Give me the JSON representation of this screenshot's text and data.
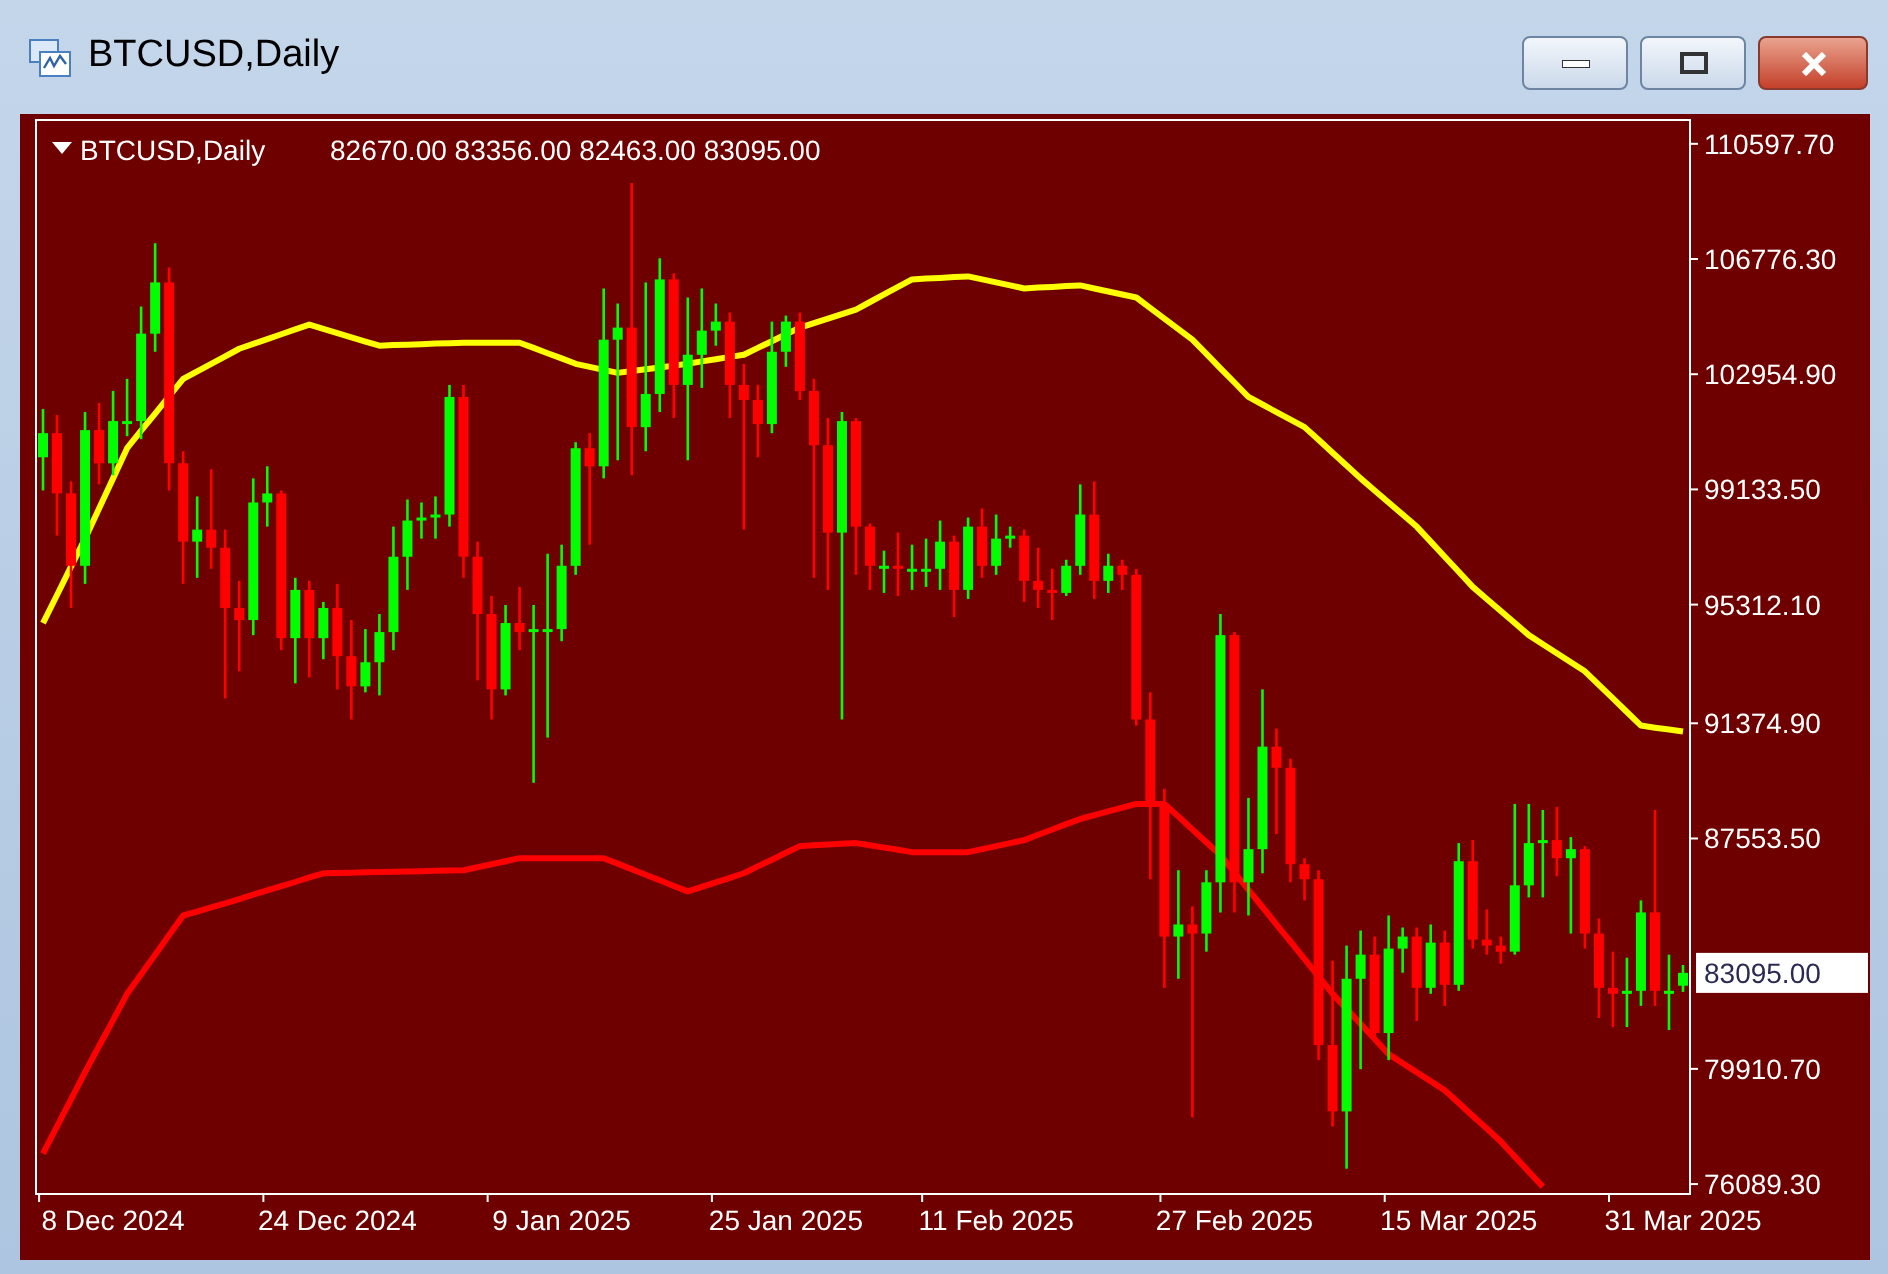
{
  "window": {
    "title": "BTCUSD,Daily"
  },
  "chart": {
    "header": {
      "symbol": "BTCUSD,Daily",
      "quote": "82670.00 83356.00 82463.00 83095.00"
    },
    "price_label": "83095.00",
    "chart_data": {
      "type": "candlestick",
      "ylim": [
        75760,
        111388
      ],
      "categories": [
        null,
        null,
        null,
        null,
        null,
        "8 Dec 2024",
        null,
        null,
        null,
        null,
        null,
        null,
        null,
        null,
        null,
        null,
        null,
        null,
        null,
        null,
        null,
        "24 Dec 2024",
        null,
        null,
        null,
        null,
        null,
        null,
        null,
        null,
        null,
        null,
        null,
        null,
        null,
        null,
        null,
        "9 Jan 2025",
        null,
        null,
        null,
        null,
        null,
        null,
        null,
        null,
        null,
        null,
        null,
        null,
        null,
        null,
        null,
        "25 Jan 2025",
        null,
        null,
        null,
        null,
        null,
        null,
        null,
        null,
        null,
        null,
        null,
        null,
        null,
        null,
        "11 Feb 2025",
        null,
        null,
        null,
        null,
        null,
        null,
        null,
        null,
        null,
        null,
        null,
        null,
        null,
        null,
        null,
        null,
        "27 Feb 2025",
        null,
        null,
        null,
        null,
        null,
        null,
        null,
        null,
        null,
        null,
        null,
        null,
        null,
        null,
        null,
        "15 Mar 2025",
        null,
        null,
        null,
        null,
        null,
        null,
        null,
        null,
        null,
        null,
        null,
        null,
        null,
        null,
        null,
        "31 Mar 2025"
      ],
      "yticks": [
        {
          "value": 110597.7,
          "label": "110597.70"
        },
        {
          "value": 106776.3,
          "label": "106776.30"
        },
        {
          "value": 102954.9,
          "label": "102954.90"
        },
        {
          "value": 99133.5,
          "label": "99133.50"
        },
        {
          "value": 95312.1,
          "label": "95312.10"
        },
        {
          "value": 91374.9,
          "label": "91374.90"
        },
        {
          "value": 87553.5,
          "label": "87553.50"
        },
        {
          "value": 79910.7,
          "label": "79910.70"
        },
        {
          "value": 76089.3,
          "label": "76089.30"
        }
      ],
      "series": [
        {
          "type": "line",
          "color": "#ffff00",
          "values": [
            94700,
            95630,
            96570,
            97500,
            98500,
            99500,
            100500,
            101080,
            101650,
            102230,
            102800,
            103050,
            103300,
            103550,
            103800,
            103960,
            104120,
            104280,
            104440,
            104600,
            104460,
            104320,
            104180,
            104040,
            103900,
            103920,
            103930,
            103950,
            103970,
            103980,
            104000,
            104000,
            104000,
            104000,
            104000,
            103830,
            103650,
            103480,
            103300,
            103200,
            103100,
            103000,
            103060,
            103120,
            103180,
            103240,
            103300,
            103380,
            103450,
            103530,
            103600,
            103830,
            104050,
            104280,
            104500,
            104650,
            104800,
            104950,
            105100,
            105350,
            105600,
            105850,
            106100,
            106130,
            106150,
            106180,
            106200,
            106100,
            106000,
            105900,
            105800,
            105830,
            105850,
            105880,
            105900,
            105800,
            105700,
            105600,
            105500,
            105150,
            104800,
            104450,
            104100,
            103630,
            103150,
            102680,
            102200,
            101950,
            101700,
            101450,
            101200,
            100780,
            100350,
            99930,
            99500,
            99100,
            98700,
            98300,
            97900,
            97400,
            96900,
            96400,
            95900,
            95500,
            95100,
            94700,
            94300,
            94000,
            93700,
            93400,
            93100,
            92650,
            92200,
            91750,
            91300,
            91230,
            91170,
            91100
          ]
        },
        {
          "type": "line",
          "color": "#ff0000",
          "values": [
            77100,
            78000,
            78900,
            79800,
            80670,
            81530,
            82400,
            83050,
            83700,
            84350,
            85000,
            85130,
            85270,
            85400,
            85540,
            85690,
            85830,
            85970,
            86110,
            86260,
            86400,
            86410,
            86420,
            86430,
            86440,
            86450,
            86460,
            86470,
            86480,
            86490,
            86500,
            86600,
            86700,
            86800,
            86900,
            86900,
            86900,
            86900,
            86900,
            86900,
            86900,
            86720,
            86530,
            86350,
            86170,
            85980,
            85800,
            85950,
            86100,
            86250,
            86400,
            86630,
            86850,
            87080,
            87300,
            87330,
            87350,
            87380,
            87400,
            87330,
            87250,
            87180,
            87100,
            87100,
            87100,
            87100,
            87100,
            87200,
            87300,
            87400,
            87500,
            87680,
            87850,
            88030,
            88200,
            88330,
            88450,
            88580,
            88700,
            88700,
            88700,
            88280,
            87850,
            87430,
            87000,
            86430,
            85850,
            85280,
            84700,
            84130,
            83550,
            82980,
            82400,
            81900,
            81400,
            80900,
            80400,
            80100,
            79800,
            79500,
            79200,
            78780,
            78350,
            77930,
            77500,
            77000,
            76500,
            76000,
            null,
            null,
            null,
            null,
            null,
            null,
            null,
            null,
            null,
            null
          ]
        }
      ],
      "ohlc": [
        [
          100200,
          101800,
          99100,
          101000
        ],
        [
          101000,
          101600,
          97600,
          99000
        ],
        [
          99000,
          99400,
          95200,
          96600
        ],
        [
          96600,
          101700,
          96000,
          101100
        ],
        [
          101100,
          102000,
          99300,
          100000
        ],
        [
          100000,
          102400,
          99600,
          101400
        ],
        [
          101400,
          102800,
          100900,
          101400
        ],
        [
          101400,
          105200,
          100800,
          104300
        ],
        [
          104300,
          107300,
          103700,
          106000
        ],
        [
          106000,
          106500,
          99100,
          100000
        ],
        [
          100000,
          100400,
          96000,
          97400
        ],
        [
          97400,
          98900,
          96200,
          97800
        ],
        [
          97800,
          99800,
          96500,
          97200
        ],
        [
          97200,
          97800,
          92200,
          95200
        ],
        [
          95200,
          96100,
          93100,
          94800
        ],
        [
          94800,
          99500,
          94300,
          98700
        ],
        [
          98700,
          99900,
          97900,
          99000
        ],
        [
          99000,
          99100,
          93800,
          94200
        ],
        [
          94200,
          96200,
          92700,
          95800
        ],
        [
          95800,
          96100,
          92900,
          94200
        ],
        [
          94200,
          95400,
          93500,
          95200
        ],
        [
          95200,
          96000,
          92500,
          93600
        ],
        [
          93600,
          94800,
          91500,
          92600
        ],
        [
          92600,
          94500,
          92400,
          93400
        ],
        [
          93400,
          95000,
          92300,
          94400
        ],
        [
          94400,
          97900,
          93800,
          96900
        ],
        [
          96900,
          98800,
          95800,
          98100
        ],
        [
          98100,
          98700,
          97500,
          98200
        ],
        [
          98200,
          98900,
          97500,
          98300
        ],
        [
          98300,
          102600,
          97900,
          102200
        ],
        [
          102200,
          102600,
          96200,
          96900
        ],
        [
          96900,
          97400,
          92800,
          95000
        ],
        [
          95000,
          95600,
          91500,
          92500
        ],
        [
          92500,
          95300,
          92300,
          94700
        ],
        [
          94700,
          95900,
          93800,
          94400
        ],
        [
          94400,
          95300,
          89400,
          94500
        ],
        [
          94500,
          97000,
          90900,
          94500
        ],
        [
          94500,
          97300,
          94100,
          96600
        ],
        [
          96600,
          100700,
          96300,
          100500
        ],
        [
          100500,
          101000,
          97300,
          99900
        ],
        [
          99900,
          105800,
          99500,
          104100
        ],
        [
          104100,
          105300,
          100100,
          104500
        ],
        [
          104500,
          109300,
          99600,
          101200
        ],
        [
          101200,
          106000,
          100400,
          102300
        ],
        [
          102300,
          106800,
          101700,
          106100
        ],
        [
          106100,
          106300,
          101500,
          102600
        ],
        [
          102600,
          105500,
          100100,
          103600
        ],
        [
          103600,
          105800,
          102500,
          104400
        ],
        [
          104400,
          105300,
          103900,
          104700
        ],
        [
          104700,
          105000,
          101500,
          102600
        ],
        [
          102600,
          103300,
          97800,
          102100
        ],
        [
          102100,
          102600,
          100200,
          101300
        ],
        [
          101300,
          104700,
          101000,
          103700
        ],
        [
          103700,
          104900,
          103200,
          104700
        ],
        [
          104700,
          105000,
          102100,
          102400
        ],
        [
          102400,
          102800,
          96200,
          100600
        ],
        [
          100600,
          101500,
          95800,
          97700
        ],
        [
          97700,
          101700,
          91500,
          101400
        ],
        [
          101400,
          101500,
          96300,
          97900
        ],
        [
          97900,
          98000,
          95800,
          96600
        ],
        [
          96600,
          97100,
          95700,
          96600
        ],
        [
          96600,
          97700,
          95600,
          96500
        ],
        [
          96500,
          97300,
          95800,
          96500
        ],
        [
          96500,
          97500,
          95900,
          96500
        ],
        [
          96500,
          98100,
          95800,
          97400
        ],
        [
          97400,
          97600,
          94900,
          95800
        ],
        [
          95800,
          98200,
          95500,
          97900
        ],
        [
          97900,
          98500,
          96200,
          96600
        ],
        [
          96600,
          98300,
          96300,
          97500
        ],
        [
          97500,
          97900,
          97200,
          97600
        ],
        [
          97600,
          97800,
          95400,
          96100
        ],
        [
          96100,
          97200,
          95200,
          95800
        ],
        [
          95800,
          96500,
          94800,
          95700
        ],
        [
          95700,
          96800,
          95600,
          96600
        ],
        [
          96600,
          99300,
          96300,
          98300
        ],
        [
          98300,
          99400,
          95500,
          96100
        ],
        [
          96100,
          97000,
          95700,
          96600
        ],
        [
          96600,
          96800,
          95800,
          96300
        ],
        [
          96300,
          96500,
          91300,
          91500
        ],
        [
          91500,
          92400,
          86200,
          88700
        ],
        [
          88700,
          89200,
          82600,
          84300
        ],
        [
          84300,
          86500,
          82900,
          84700
        ],
        [
          84700,
          85300,
          78300,
          84400
        ],
        [
          84400,
          86500,
          83800,
          86100
        ],
        [
          86100,
          95000,
          85100,
          94300
        ],
        [
          94300,
          94400,
          85100,
          86100
        ],
        [
          86100,
          88900,
          85000,
          87200
        ],
        [
          87200,
          92500,
          86400,
          90600
        ],
        [
          90600,
          91200,
          87700,
          89900
        ],
        [
          89900,
          90200,
          86100,
          86700
        ],
        [
          86700,
          86900,
          85500,
          86200
        ],
        [
          86200,
          86500,
          80200,
          80700
        ],
        [
          80700,
          83500,
          78000,
          78500
        ],
        [
          78500,
          84000,
          76600,
          82900
        ],
        [
          82900,
          84500,
          79900,
          83700
        ],
        [
          83700,
          84300,
          80800,
          81100
        ],
        [
          81100,
          85000,
          80200,
          83900
        ],
        [
          83900,
          84600,
          83100,
          84300
        ],
        [
          84300,
          84600,
          81500,
          82600
        ],
        [
          82600,
          84700,
          82400,
          84100
        ],
        [
          84100,
          84500,
          82000,
          82700
        ],
        [
          82700,
          87400,
          82500,
          86800
        ],
        [
          86800,
          87500,
          83900,
          84200
        ],
        [
          84200,
          85200,
          83700,
          84000
        ],
        [
          84000,
          84300,
          83400,
          83800
        ],
        [
          83800,
          88700,
          83700,
          86000
        ],
        [
          86000,
          88700,
          85600,
          87400
        ],
        [
          87400,
          88500,
          85600,
          87500
        ],
        [
          87500,
          88600,
          86300,
          86900
        ],
        [
          86900,
          87600,
          84400,
          87200
        ],
        [
          87200,
          87300,
          83900,
          84400
        ],
        [
          84400,
          84900,
          81600,
          82600
        ],
        [
          82600,
          83800,
          81300,
          82400
        ],
        [
          82400,
          83600,
          81300,
          82500
        ],
        [
          82500,
          85500,
          82000,
          85100
        ],
        [
          85100,
          88500,
          82000,
          82500
        ],
        [
          82500,
          83700,
          81200,
          82500
        ],
        [
          82670,
          83356,
          82463,
          83095
        ]
      ]
    }
  }
}
